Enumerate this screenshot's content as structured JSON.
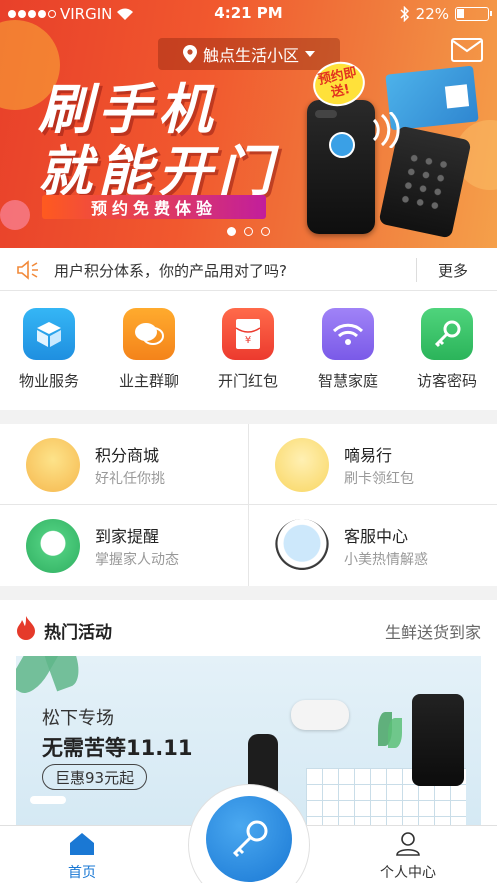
{
  "status_bar": {
    "carrier": "VIRGIN",
    "time": "4:21 PM",
    "battery": "22%"
  },
  "banner": {
    "location": "触点生活小区",
    "headline_line1": "刷手机",
    "headline_line2": "就能开门",
    "subtitle": "预约免费体验",
    "bubble": "预约即送!",
    "page_count": 3,
    "active_page": 1
  },
  "notice": {
    "text": "用户积分体系，你的产品用对了吗?",
    "more": "更多"
  },
  "services": [
    {
      "label": "物业服务",
      "icon": "box-icon",
      "color": "#2c9fe8"
    },
    {
      "label": "业主群聊",
      "icon": "chat-icon",
      "color": "#f6901e"
    },
    {
      "label": "开门红包",
      "icon": "red-envelope-icon",
      "color": "#f04434"
    },
    {
      "label": "智慧家庭",
      "icon": "wifi-icon",
      "color": "#8e6cf2"
    },
    {
      "label": "访客密码",
      "icon": "key-icon",
      "color": "#39c46a"
    }
  ],
  "features": [
    {
      "title": "积分商城",
      "sub": "好礼任你挑"
    },
    {
      "title": "嘀易行",
      "sub": "刷卡领红包"
    },
    {
      "title": "到家提醒",
      "sub": "掌握家人动态"
    },
    {
      "title": "客服中心",
      "sub": "小美热情解惑"
    }
  ],
  "hot": {
    "title": "热门活动",
    "right": "生鲜送货到家",
    "promo_line1": "松下专场",
    "promo_line2": "无需苦等11.11",
    "promo_badge": "巨惠93元起"
  },
  "tabbar": {
    "home": "首页",
    "profile": "个人中心",
    "active": "home",
    "accent": "#1a78d4"
  }
}
